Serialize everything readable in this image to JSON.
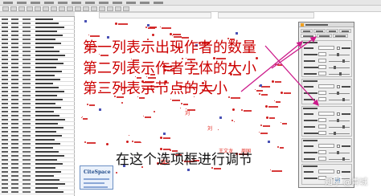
{
  "menubar": {
    "items": [
      "[menu]",
      "[menu]",
      "[menu]",
      "[menu]",
      "[menu]",
      "[menu]",
      "[menu]",
      "[menu]",
      "[menu]",
      "[menu]",
      "[menu]",
      "[menu]"
    ]
  },
  "toolbar": {
    "buttons": [
      "[tool]",
      "[tool]",
      "[tool]",
      "[tool]",
      "[tool]",
      "[tool]",
      "[tool]",
      "[tool]",
      "[tool]",
      "[tool]",
      "[tool]",
      "[tool]",
      "[tool]",
      "[tool]",
      "[tool]",
      "[tool]"
    ]
  },
  "table": {
    "headers": [
      "[col]",
      "[col]",
      "[col]",
      "[col]"
    ],
    "rows": [
      "[row]"
    ]
  },
  "graph": {
    "readable_labels": [
      "王文龙",
      "周国",
      "刘",
      "刘",
      "魏文"
    ],
    "logo": "CiteSpace"
  },
  "annotations": [
    "第一列表示出现作者的数量",
    "第二列表示作者字体的大小",
    "第三列表示节点的大小",
    "在这个选项框进行调节"
  ],
  "dialog": {
    "title": "[dialog title]",
    "tabs": [
      "[tab]",
      "[tab]",
      "[tab]",
      "[tab]",
      "[tab]",
      "[tab]",
      "[tab]"
    ]
  },
  "watermark": {
    "text": "知乎 @青城"
  },
  "colors": {
    "annotation_text": "#cc0000",
    "annotation_arrow": "#cc1a8a",
    "node_red": "#d01818",
    "node_blue": "#4a52b5"
  }
}
